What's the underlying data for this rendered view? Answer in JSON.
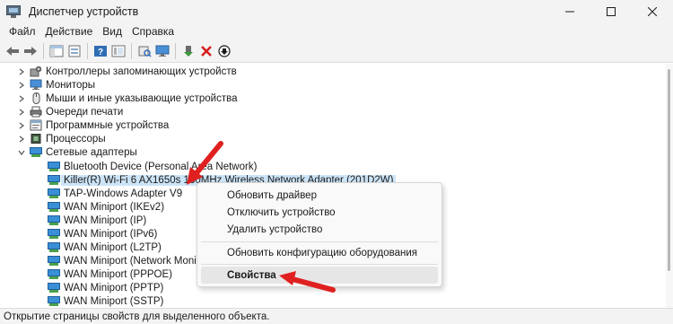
{
  "window": {
    "title": "Диспетчер устройств"
  },
  "menu": [
    "Файл",
    "Действие",
    "Вид",
    "Справка"
  ],
  "toolbar": {
    "buttons": [
      "back-icon",
      "forward-icon",
      "properties-pane-icon",
      "show-hidden-icon",
      "help-icon",
      "details-icon",
      "scan-hardware-icon",
      "monitor-icon",
      "update-driver-icon",
      "uninstall-icon",
      "disable-icon"
    ]
  },
  "tree": {
    "categories": [
      {
        "label": "Контроллеры запоминающих устройств",
        "expanded": false
      },
      {
        "label": "Мониторы",
        "expanded": false
      },
      {
        "label": "Мыши и иные указывающие устройства",
        "expanded": false
      },
      {
        "label": "Очереди печати",
        "expanded": false
      },
      {
        "label": "Программные устройства",
        "expanded": false
      },
      {
        "label": "Процессоры",
        "expanded": false
      },
      {
        "label": "Сетевые адаптеры",
        "expanded": true
      }
    ],
    "network_adapters": [
      {
        "label": "Bluetooth Device (Personal Area Network)",
        "selected": false
      },
      {
        "label": "Killer(R) Wi-Fi 6 AX1650s 160MHz Wireless Network Adapter (201D2W)",
        "selected": true
      },
      {
        "label": "TAP-Windows Adapter V9",
        "selected": false
      },
      {
        "label": "WAN Miniport (IKEv2)",
        "selected": false
      },
      {
        "label": "WAN Miniport (IP)",
        "selected": false
      },
      {
        "label": "WAN Miniport (IPv6)",
        "selected": false
      },
      {
        "label": "WAN Miniport (L2TP)",
        "selected": false
      },
      {
        "label": "WAN Miniport (Network Monitor)",
        "selected": false
      },
      {
        "label": "WAN Miniport (PPPOE)",
        "selected": false
      },
      {
        "label": "WAN Miniport (PPTP)",
        "selected": false
      },
      {
        "label": "WAN Miniport (SSTP)",
        "selected": false
      }
    ]
  },
  "context_menu": {
    "items": [
      {
        "label": "Обновить драйвер",
        "highlighted": false
      },
      {
        "label": "Отключить устройство",
        "highlighted": false
      },
      {
        "label": "Удалить устройство",
        "highlighted": false
      },
      {
        "label": "Обновить конфигурацию оборудования",
        "highlighted": false
      },
      {
        "label": "Свойства",
        "highlighted": true
      }
    ]
  },
  "status": {
    "text": "Открытие страницы свойств для выделенного объекта."
  },
  "colors": {
    "selection": "#cce4f7",
    "annotation_arrow": "#e02020"
  }
}
